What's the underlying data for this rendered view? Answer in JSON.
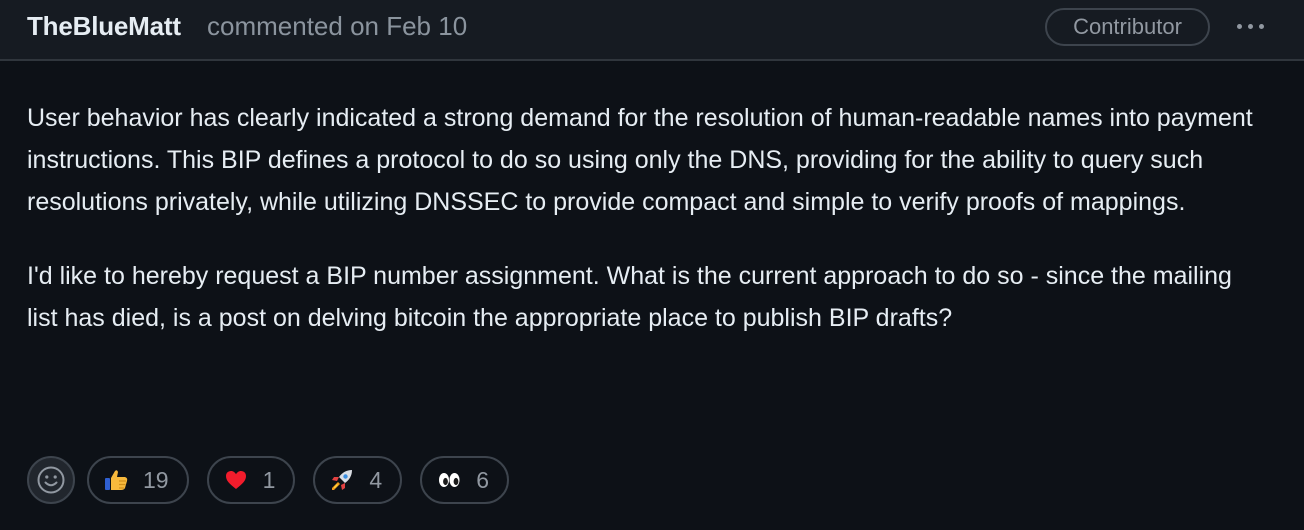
{
  "header": {
    "author": "TheBlueMatt",
    "meta": "commented on Feb 10",
    "role_badge": "Contributor",
    "more_icon": "kebab-horizontal-icon"
  },
  "body": {
    "paragraphs": [
      "User behavior has clearly indicated a strong demand for the resolution of human-readable names into payment instructions. This BIP defines a protocol to do so using only the DNS, providing for the ability to query such resolutions privately, while utilizing DNSSEC to provide compact and simple to verify proofs of mappings.",
      "I'd like to hereby request a BIP number assignment. What is the current approach to do so - since the mailing list has died, is a post on delving bitcoin the appropriate place to publish BIP drafts?"
    ]
  },
  "reactions": {
    "add_icon": "smiley-icon",
    "items": [
      {
        "icon": "thumbs-up-icon",
        "count": "19"
      },
      {
        "icon": "heart-icon",
        "count": "1"
      },
      {
        "icon": "rocket-icon",
        "count": "4"
      },
      {
        "icon": "eyes-icon",
        "count": "6"
      }
    ]
  },
  "colors": {
    "background": "#0d1117",
    "header_background": "#161b22",
    "border": "#30363d",
    "text": "#e6edf3",
    "muted": "#8b949e"
  }
}
